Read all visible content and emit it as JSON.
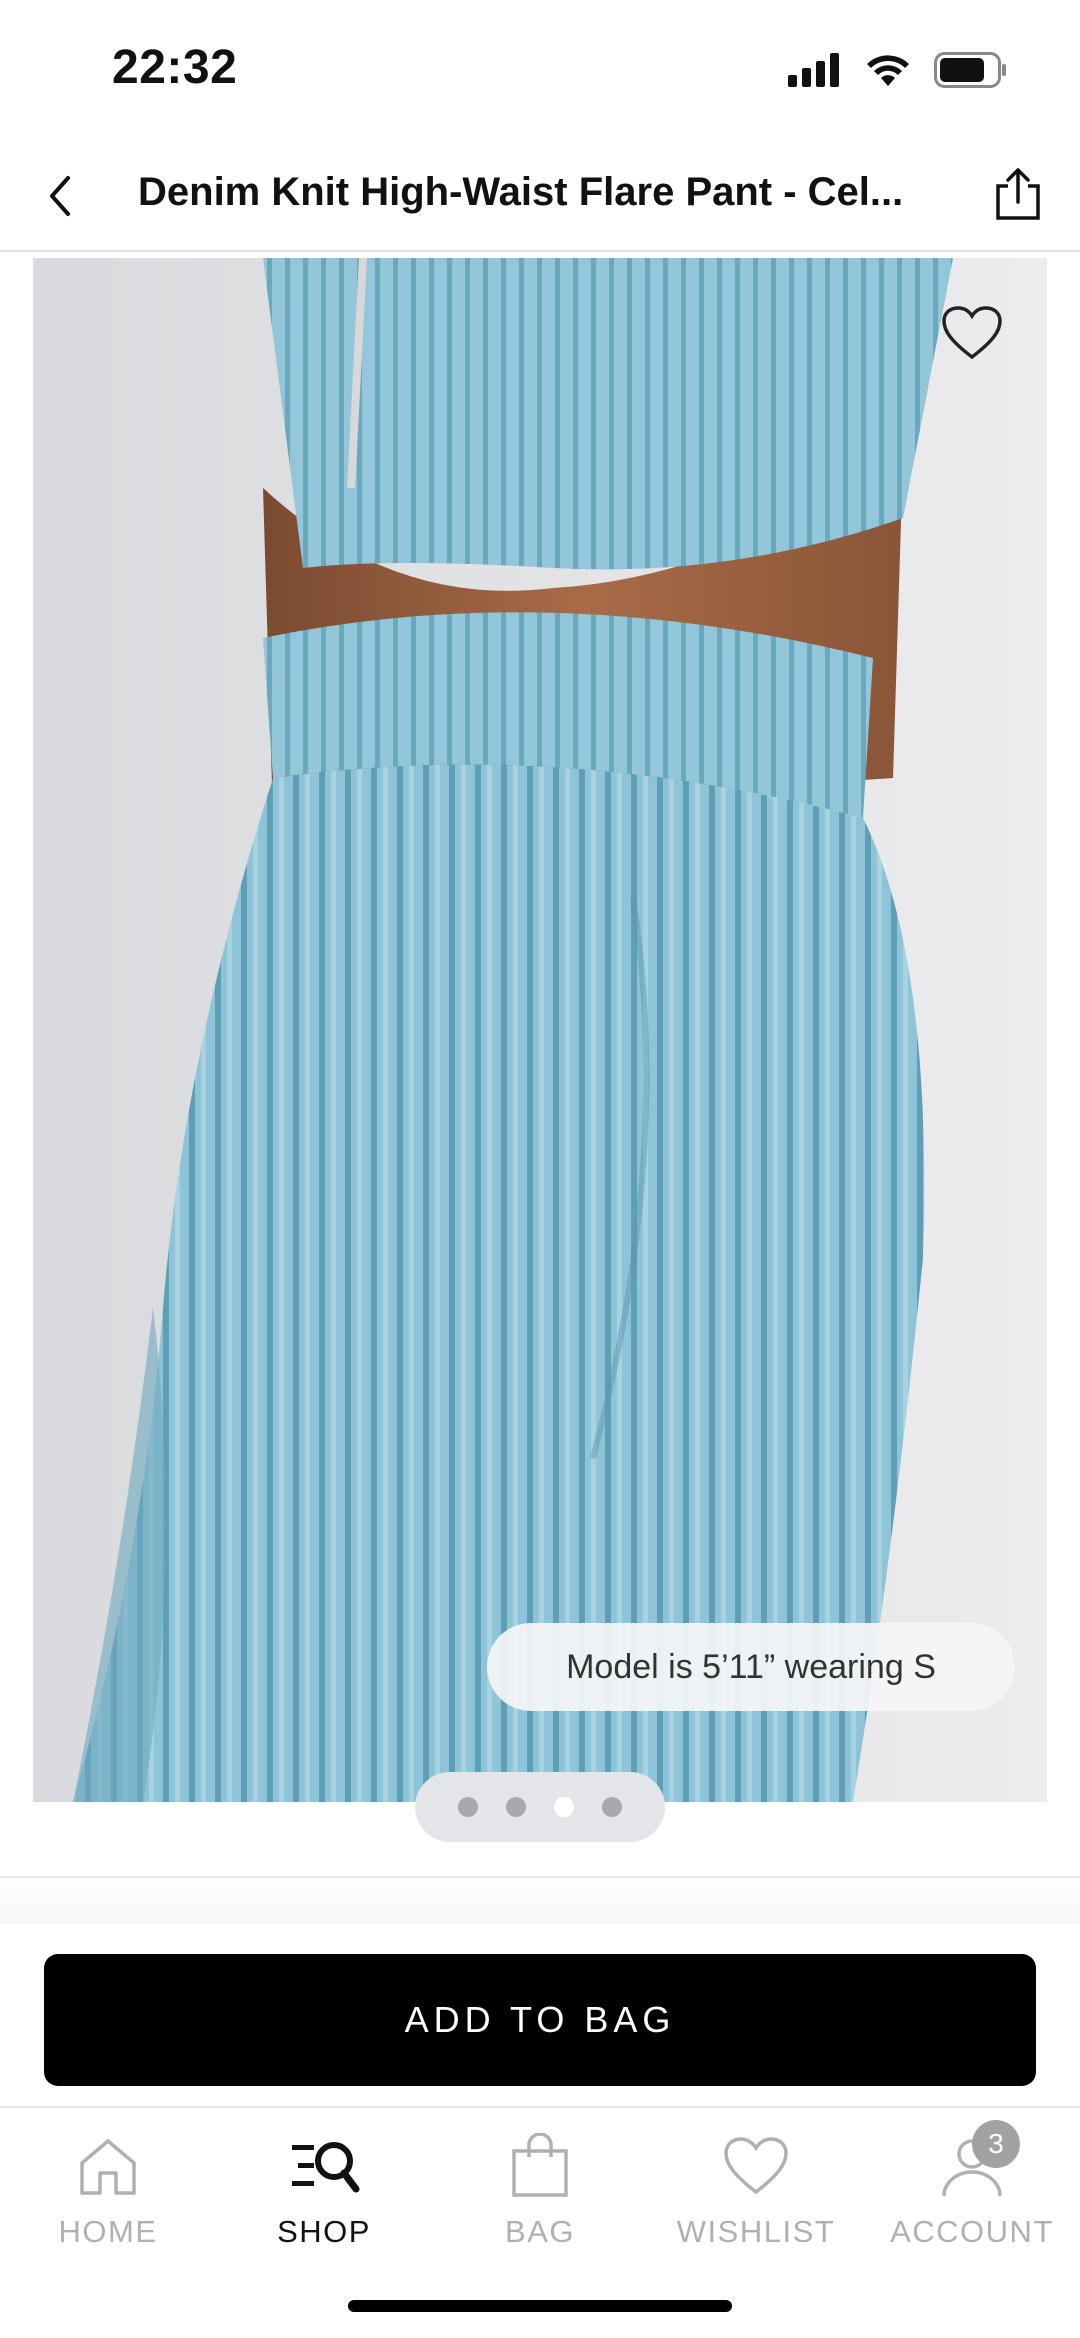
{
  "status_bar": {
    "time": "22:32"
  },
  "header": {
    "title": "Denim Knit High-Waist Flare Pant - Cel..."
  },
  "gallery": {
    "model_info": "Model is 5’11” wearing S",
    "page_count": 4,
    "active_page": 3
  },
  "cta": {
    "add_to_bag": "ADD TO BAG"
  },
  "bottom_nav": {
    "items": [
      {
        "label": "HOME",
        "icon": "home-icon"
      },
      {
        "label": "SHOP",
        "icon": "shop-search-icon",
        "active": true
      },
      {
        "label": "BAG",
        "icon": "bag-icon"
      },
      {
        "label": "WISHLIST",
        "icon": "heart-icon"
      },
      {
        "label": "ACCOUNT",
        "icon": "account-icon",
        "badge": "3"
      }
    ]
  },
  "colors": {
    "accent": "#000000",
    "product": "#8fc3d6",
    "inactive_nav": "#b0b0b0"
  }
}
